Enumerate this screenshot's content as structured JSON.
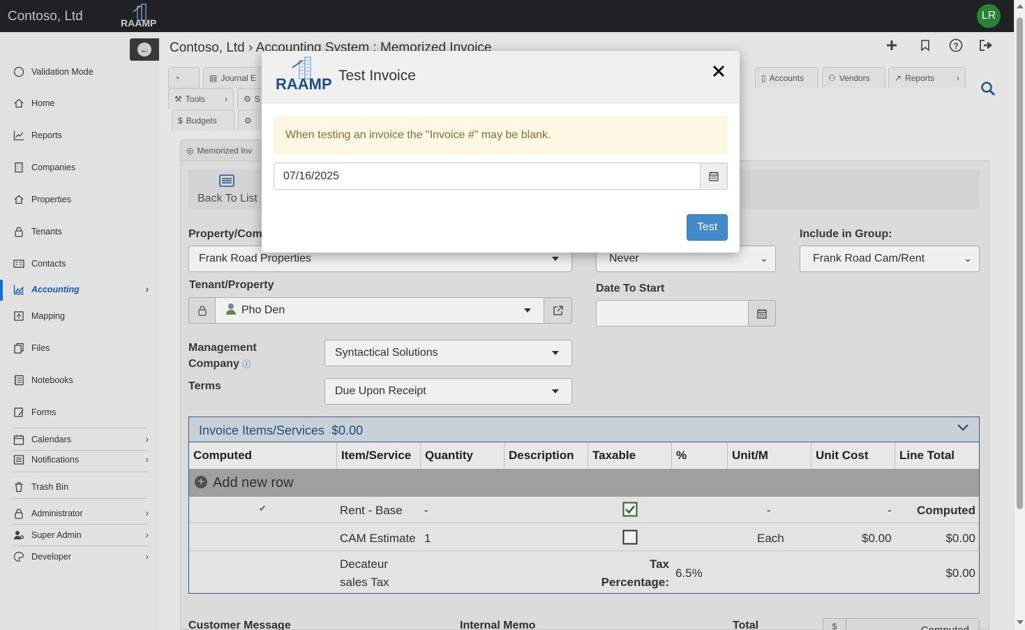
{
  "app": {
    "brand": "Contoso, Ltd",
    "logo_text": "RAAMP",
    "avatar_initials": "LR",
    "colors": {
      "topbar": "#222426",
      "accent": "#428bca",
      "active_nav": "#1a5fb4",
      "avatar": "#2e8b3a",
      "alert_bg": "#fcf8e3",
      "alert_text": "#8a6d3b"
    }
  },
  "breadcrumb": "Contoso, Ltd › Accounting System : Memorized Invoice",
  "header_icons": [
    "plus-icon",
    "bookmark-icon",
    "help-icon",
    "logout-icon"
  ],
  "sidebar": {
    "items": [
      {
        "label": "Validation Mode",
        "icon": "circle-icon"
      },
      {
        "label": "Home",
        "icon": "home-icon"
      },
      {
        "label": "Reports",
        "icon": "chart-icon"
      },
      {
        "label": "Companies",
        "icon": "building-icon"
      },
      {
        "label": "Properties",
        "icon": "home-icon"
      },
      {
        "label": "Tenants",
        "icon": "lock-icon"
      },
      {
        "label": "Contacts",
        "icon": "id-card-icon"
      },
      {
        "label": "Accounting",
        "icon": "chart-area-icon",
        "active": true
      },
      {
        "label": "Mapping",
        "icon": "map-icon"
      },
      {
        "label": "Files",
        "icon": "files-icon"
      },
      {
        "label": "Notebooks",
        "icon": "notebook-icon"
      },
      {
        "label": "Forms",
        "icon": "form-icon"
      },
      {
        "label": "Calendars",
        "icon": "calendar-icon"
      },
      {
        "label": "Notifications",
        "icon": "notifications-icon"
      },
      {
        "label": "Trash Bin",
        "icon": "trash-icon"
      },
      {
        "label": "Administrator",
        "icon": "lock-icon"
      },
      {
        "label": "Super Admin",
        "icon": "user-cog-icon"
      },
      {
        "label": "Developer",
        "icon": "palette-icon"
      }
    ]
  },
  "tabs": {
    "row1": [
      "",
      "Journal E",
      "Accounts",
      "Vendors",
      "Reports"
    ],
    "row2": [
      "Tools",
      "S"
    ],
    "row3": [
      "Budgets",
      ""
    ],
    "sub_tab": "Memorized Inv"
  },
  "form": {
    "back_to_list": "Back To List",
    "property_label": "Property/Com",
    "property_value": "Frank Road Properties",
    "tenant_label": "Tenant/Property",
    "tenant_value": "Pho Den",
    "management_label_1": "Management",
    "management_label_2": "Company",
    "management_value": "Syntactical Solutions",
    "terms_label": "Terms",
    "terms_value": "Due Upon Receipt",
    "repeat_value": "Never",
    "date_to_start_label": "Date To Start",
    "date_to_start_value": "",
    "include_group_label": "Include in Group:",
    "include_group_value": "Frank Road Cam/Rent"
  },
  "items": {
    "title": "Invoice Items/Services",
    "total": "$0.00",
    "columns": [
      "Computed",
      "Item/Service",
      "Quantity",
      "Description",
      "Taxable",
      "%",
      "Unit/M",
      "Unit Cost",
      "Line Total"
    ],
    "add_row_label": "Add new row",
    "rows": [
      {
        "computed": "✔",
        "item": "Rent - Base",
        "quantity": "-",
        "taxable": true,
        "unit": "-",
        "unit_cost": "-",
        "line_total": "Computed"
      },
      {
        "computed": "",
        "item": "CAM Estimate",
        "quantity": "1",
        "taxable": false,
        "unit": "Each",
        "unit_cost": "$0.00",
        "line_total": "$0.00"
      },
      {
        "item_line1": "Decateur",
        "item_line2": "sales Tax",
        "tax_label_1": "Tax",
        "tax_label_2": "Percentage:",
        "tax_pct": "6.5%",
        "line_total": "$0.00"
      }
    ]
  },
  "bottom": {
    "customer_message": "Customer Message",
    "internal_memo": "Internal Memo",
    "total": "Total",
    "total_prefix": "$",
    "total_value": "Computed"
  },
  "modal": {
    "title": "Test Invoice",
    "close": "✕",
    "alert": "When testing an invoice the \"Invoice #\" may be blank.",
    "date_value": "07/16/2025",
    "test_button": "Test"
  }
}
